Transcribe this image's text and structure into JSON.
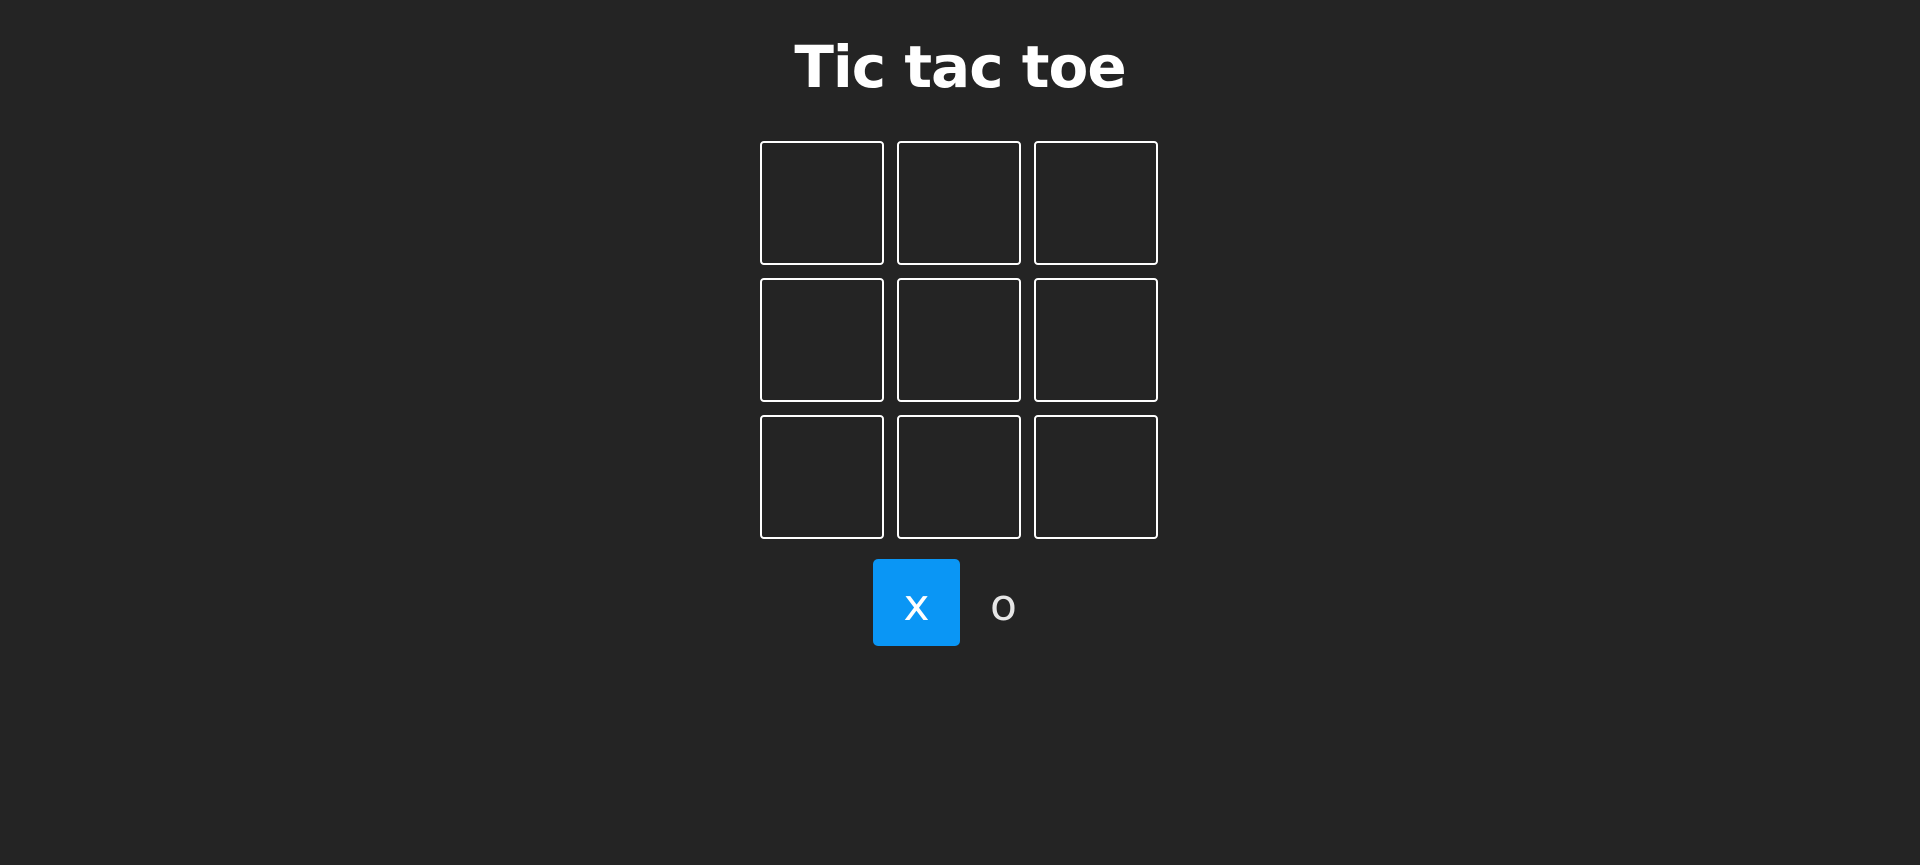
{
  "title": "Tic tac toe",
  "board": {
    "cells": [
      "",
      "",
      "",
      "",
      "",
      "",
      "",
      "",
      ""
    ]
  },
  "players": {
    "x_label": "x",
    "o_label": "o",
    "active": "x"
  },
  "colors": {
    "background": "#242424",
    "accent": "#0a96f5",
    "cell_border": "#ffffff",
    "text": "#ffffff"
  }
}
